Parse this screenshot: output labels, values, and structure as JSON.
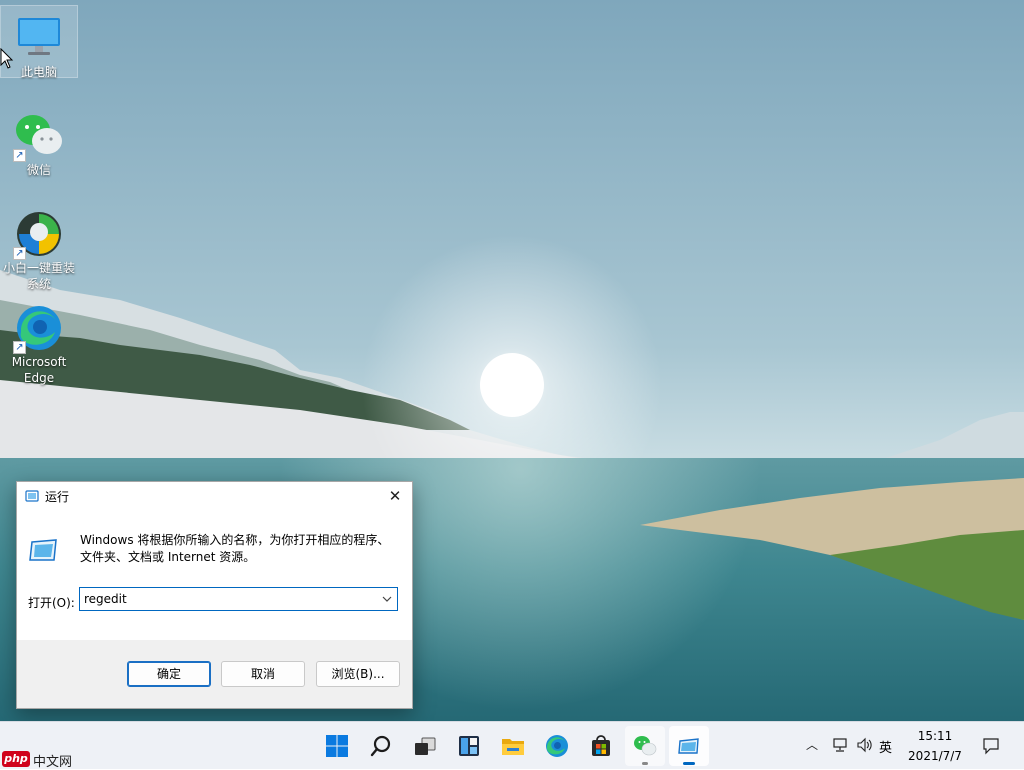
{
  "desktop": {
    "icons": [
      {
        "label": "此电脑",
        "icon": "computer-icon"
      },
      {
        "label": "微信",
        "icon": "wechat-icon"
      },
      {
        "label": "小白一键重装系统",
        "icon": "xiaobai-reinstall-icon"
      },
      {
        "label": "Microsoft Edge",
        "icon": "edge-icon"
      }
    ]
  },
  "run_dialog": {
    "title": "运行",
    "description": "Windows 将根据你所输入的名称，为你打开相应的程序、文件夹、文档或 Internet 资源。",
    "open_label": "打开(O):",
    "input_value": "regedit",
    "buttons": {
      "ok": "确定",
      "cancel": "取消",
      "browse": "浏览(B)..."
    }
  },
  "taskbar": {
    "apps": [
      {
        "name": "start",
        "icon": "windows-start-icon"
      },
      {
        "name": "search",
        "icon": "search-icon"
      },
      {
        "name": "task-view",
        "icon": "task-view-icon"
      },
      {
        "name": "widgets",
        "icon": "widgets-icon"
      },
      {
        "name": "file-explorer",
        "icon": "folder-icon"
      },
      {
        "name": "edge",
        "icon": "edge-icon"
      },
      {
        "name": "store",
        "icon": "store-icon"
      },
      {
        "name": "wechat",
        "icon": "wechat-icon"
      },
      {
        "name": "run",
        "icon": "run-icon"
      }
    ],
    "tray": {
      "ime": "英",
      "time": "15:11",
      "date": "2021/7/7"
    }
  },
  "watermark": {
    "badge": "php",
    "text": "中文网"
  },
  "colors": {
    "accent": "#0067c0",
    "taskbar": "#eef1f6",
    "dialog_footer": "#f0f0f0"
  }
}
